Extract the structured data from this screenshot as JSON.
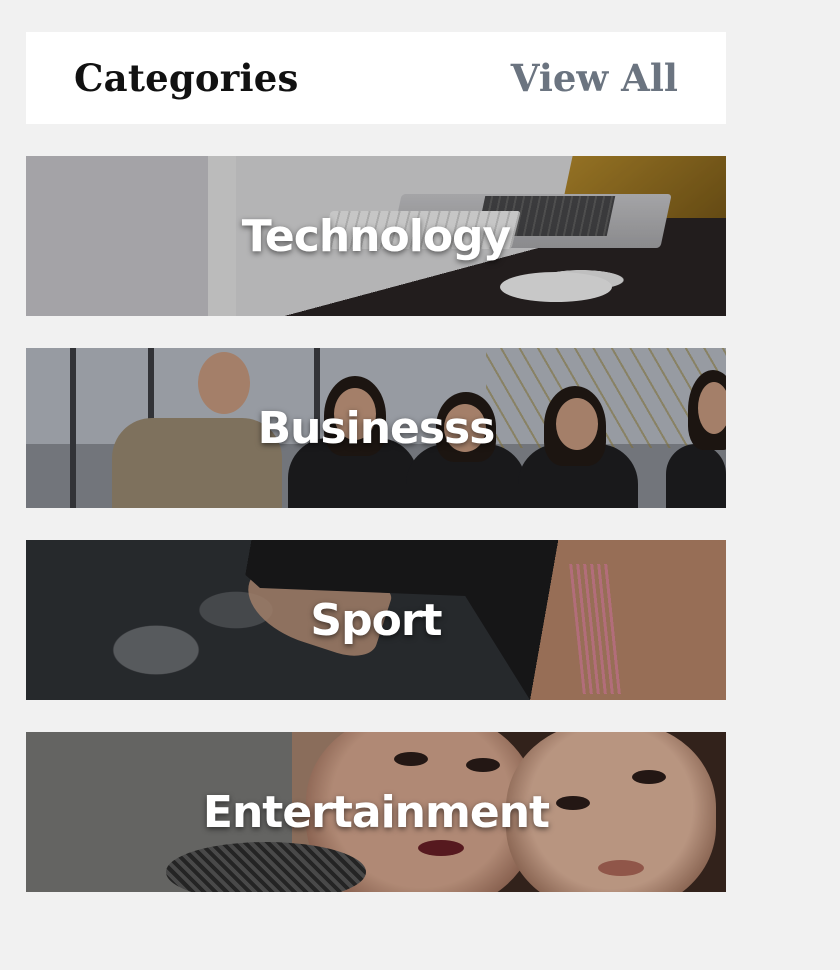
{
  "header": {
    "title": "Categories",
    "view_all": "View All"
  },
  "categories": [
    {
      "label": "Technology"
    },
    {
      "label": "Businesss"
    },
    {
      "label": "Sport"
    },
    {
      "label": "Entertainment"
    }
  ],
  "colors": {
    "background": "#f1f1f1",
    "header_bg": "#ffffff",
    "title": "#111111",
    "link": "#6b7480",
    "card_label": "#ffffff"
  }
}
